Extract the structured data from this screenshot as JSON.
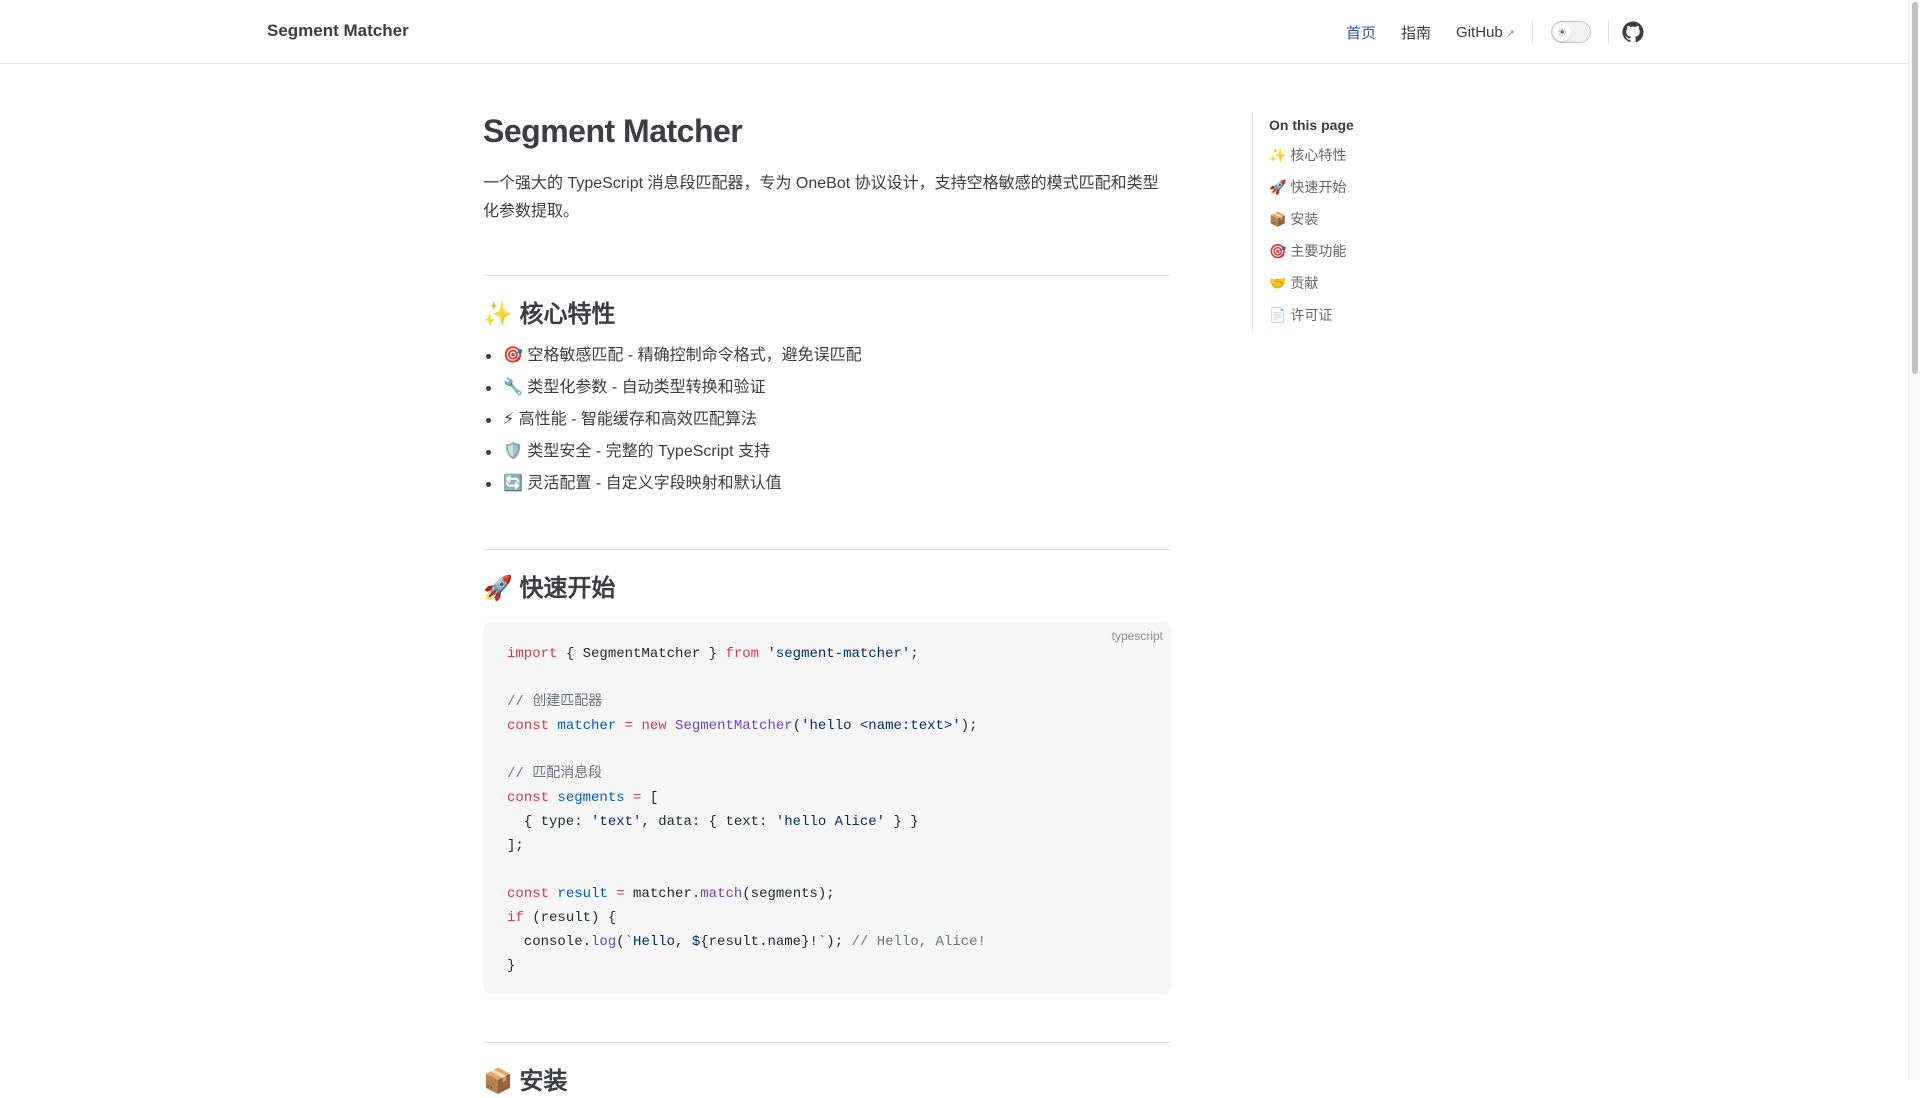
{
  "nav": {
    "site_title": "Segment Matcher",
    "links": [
      {
        "label": "首页"
      },
      {
        "label": "指南"
      },
      {
        "label": "GitHub",
        "external_arrow": "↗"
      }
    ],
    "theme_icon": "☀"
  },
  "main": {
    "title": "Segment Matcher",
    "intro": "一个强大的 TypeScript 消息段匹配器，专为 OneBot 协议设计，支持空格敏感的模式匹配和类型化参数提取。",
    "sections": {
      "features": {
        "heading": "✨ 核心特性",
        "items": [
          "🎯 空格敏感匹配 - 精确控制命令格式，避免误匹配",
          "🔧 类型化参数 - 自动类型转换和验证",
          "⚡ 高性能 - 智能缓存和高效匹配算法",
          "🛡️ 类型安全 - 完整的 TypeScript 支持",
          "🔄 灵活配置 - 自定义字段映射和默认值"
        ]
      },
      "quickstart": {
        "heading": "🚀 快速开始",
        "code_lang": "typescript",
        "code": {
          "l1_import": "import",
          "l1_mid": " { SegmentMatcher } ",
          "l1_from": "from",
          "l1_sp": " ",
          "l1_str": "'segment-matcher'",
          "l1_end": ";",
          "l3_comment": "// 创建匹配器",
          "l4_const": "const",
          "l4_var": " matcher",
          "l4_eq": " =",
          "l4_new": " new",
          "l4_cls": " SegmentMatcher",
          "l4_open": "(",
          "l4_str": "'hello <name:text>'",
          "l4_close": ");",
          "l6_comment": "// 匹配消息段",
          "l7_const": "const",
          "l7_var": " segments",
          "l7_eq": " =",
          "l7_rest": " [",
          "l8_a": "  { type: ",
          "l8_s1": "'text'",
          "l8_b": ", data: { text: ",
          "l8_s2": "'hello Alice'",
          "l8_c": " } }",
          "l9": "];",
          "l11_const": "const",
          "l11_var": " result",
          "l11_eq": " =",
          "l11_a": " matcher.",
          "l11_fn": "match",
          "l11_b": "(segments);",
          "l12_if": "if",
          "l12_rest": " (result) {",
          "l13_a": "  console.",
          "l13_fn": "log",
          "l13_b": "(",
          "l13_s1": "`Hello, ${",
          "l13_c": "result.name",
          "l13_s2": "}!`",
          "l13_d": "); ",
          "l13_com": "// Hello, Alice!",
          "l14": "}"
        }
      },
      "install": {
        "heading": "📦 安装"
      }
    }
  },
  "toc": {
    "title": "On this page",
    "items": [
      "✨ 核心特性",
      "🚀 快速开始",
      "📦 安装",
      "🎯 主要功能",
      "🤝 贡献",
      "📄 许可证"
    ]
  },
  "colors": {
    "accent": "#3451b2",
    "text": "#3c3c43",
    "code_bg": "#f6f6f7"
  }
}
